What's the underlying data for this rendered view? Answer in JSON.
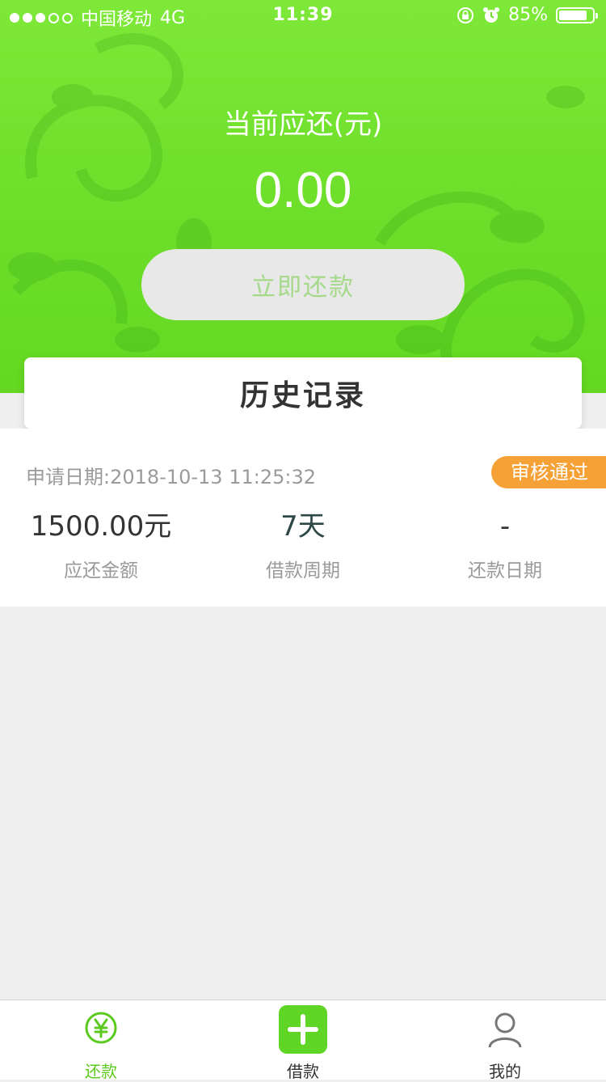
{
  "status_bar": {
    "carrier": "中国移动",
    "network": "4G",
    "time": "11:39",
    "battery": "85%",
    "battery_level": 0.85
  },
  "summary": {
    "due_label": "当前应还(元)",
    "due_amount": "0.00",
    "repay_button": "立即还款"
  },
  "history": {
    "title": "历史记录",
    "records": [
      {
        "apply_date": "申请日期:2018-10-13 11:25:32",
        "status": "审核通过",
        "amount": "1500.00元",
        "amount_label": "应还金额",
        "period": "7天",
        "period_label": "借款周期",
        "repay_date": "-",
        "repay_date_label": "还款日期"
      }
    ]
  },
  "tabbar": {
    "items": [
      {
        "label": "还款",
        "icon": "yen-circle-icon",
        "active": true
      },
      {
        "label": "借款",
        "icon": "plus-icon",
        "active": false
      },
      {
        "label": "我的",
        "icon": "user-icon",
        "active": false
      }
    ]
  },
  "colors": {
    "brand_green": "#6fe02c",
    "status_orange": "#f6a136",
    "active_tab": "#5cc91f"
  }
}
